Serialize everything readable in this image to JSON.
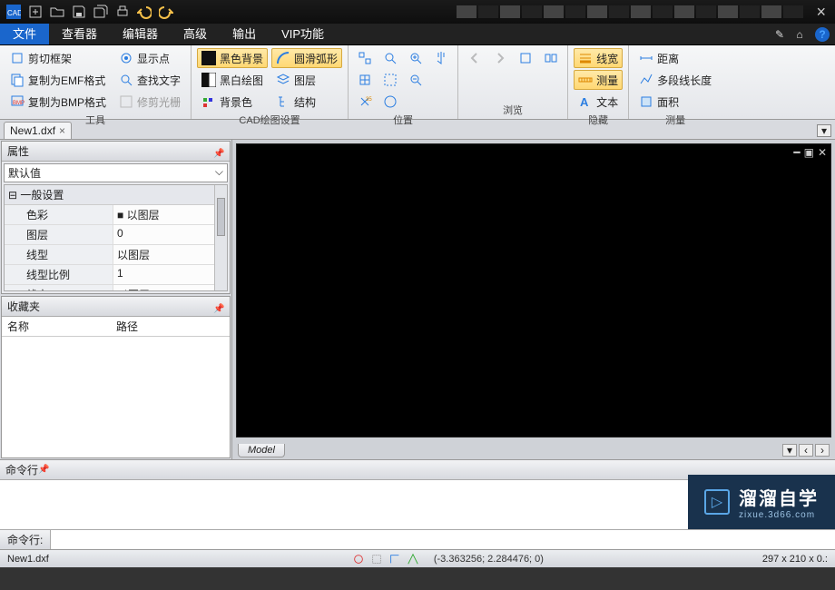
{
  "qat_icons": [
    "cad",
    "new",
    "open",
    "save",
    "saveall",
    "print",
    "undo",
    "redo"
  ],
  "menus": {
    "tabs": [
      "文件",
      "查看器",
      "编辑器",
      "高级",
      "输出",
      "VIP功能"
    ],
    "active": 0
  },
  "ribbon": {
    "group1": {
      "title": "工具",
      "items": [
        "剪切框架",
        "复制为EMF格式",
        "复制为BMP格式",
        "显示点",
        "查找文字",
        "修剪光栅"
      ]
    },
    "group2": {
      "title": "CAD绘图设置",
      "items": [
        "黑色背景",
        "黑白绘图",
        "背景色",
        "圆滑弧形",
        "图层",
        "结构"
      ],
      "selected": [
        0,
        3
      ]
    },
    "group3": {
      "title": "位置"
    },
    "group4": {
      "title": "浏览"
    },
    "group5": {
      "title": "隐藏",
      "items": [
        "线宽",
        "测量",
        "文本"
      ],
      "selected": [
        0,
        1
      ]
    },
    "group6": {
      "title": "测量",
      "items": [
        "距离",
        "多段线长度",
        "面积"
      ]
    }
  },
  "doc": {
    "tab": "New1.dxf"
  },
  "props": {
    "title": "属性",
    "dropdown": "默认值",
    "section": "一般设置",
    "rows": [
      [
        "色彩",
        "以图层"
      ],
      [
        "图层",
        "0"
      ],
      [
        "线型",
        "以图层"
      ],
      [
        "线型比例",
        "1"
      ],
      [
        "线宽",
        "以图层"
      ]
    ]
  },
  "fav": {
    "title": "收藏夹",
    "cols": [
      "名称",
      "路径"
    ]
  },
  "canvas": {
    "modeltab": "Model"
  },
  "cmd": {
    "title": "命令行",
    "prompt": "命令行:"
  },
  "watermark": {
    "main": "溜溜自学",
    "sub": "zixue.3d66.com"
  },
  "status": {
    "file": "New1.dxf",
    "coords": "(-3.363256; 2.284476; 0)",
    "dims": "297 x 210 x 0.:"
  }
}
